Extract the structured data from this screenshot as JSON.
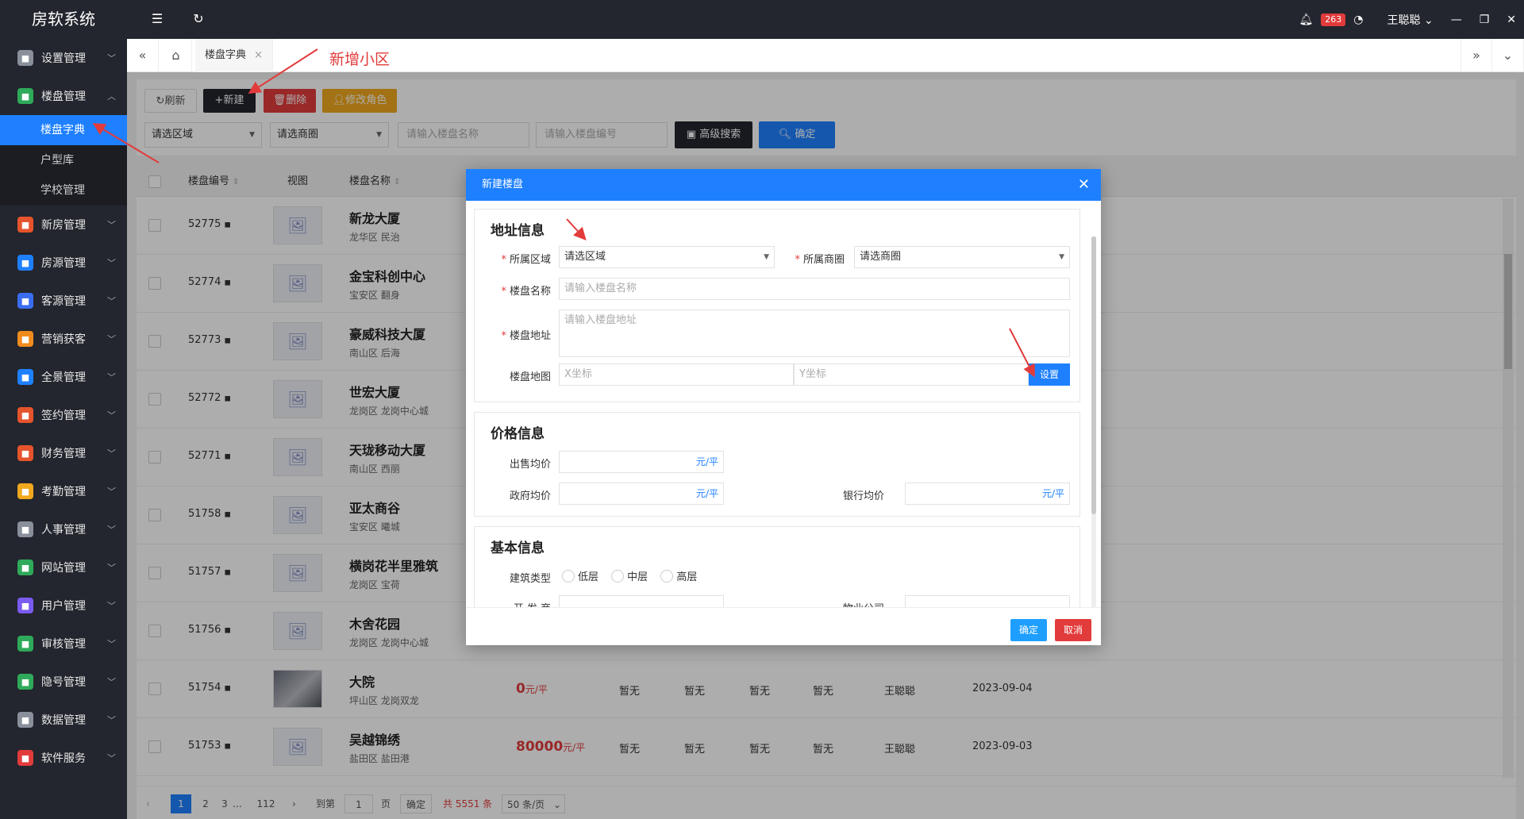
{
  "app": {
    "title": "房软系统",
    "notif_count": "263",
    "user": "王聪聪"
  },
  "sidebar": {
    "items": [
      {
        "label": "设置管理",
        "icon": "gear-icon",
        "color": "#8a8f9c"
      },
      {
        "label": "楼盘管理",
        "icon": "building-icon",
        "color": "#2eaa5a",
        "open": true,
        "children": [
          {
            "label": "楼盘字典",
            "active": true
          },
          {
            "label": "户型库"
          },
          {
            "label": "学校管理"
          }
        ]
      },
      {
        "label": "新房管理",
        "icon": "house-icon",
        "color": "#e5542d"
      },
      {
        "label": "房源管理",
        "icon": "home-icon",
        "color": "#1e80ff"
      },
      {
        "label": "客源管理",
        "icon": "users-icon",
        "color": "#3a6df0"
      },
      {
        "label": "营销获客",
        "icon": "share-icon",
        "color": "#f08c1e"
      },
      {
        "label": "全景管理",
        "icon": "panorama-icon",
        "color": "#1e80ff"
      },
      {
        "label": "签约管理",
        "icon": "contract-icon",
        "color": "#e5542d"
      },
      {
        "label": "财务管理",
        "icon": "finance-icon",
        "color": "#e5542d"
      },
      {
        "label": "考勤管理",
        "icon": "clock-icon",
        "color": "#f0a81e"
      },
      {
        "label": "人事管理",
        "icon": "person-icon",
        "color": "#8a8f9c"
      },
      {
        "label": "网站管理",
        "icon": "web-icon",
        "color": "#2eaa5a"
      },
      {
        "label": "用户管理",
        "icon": "user-icon",
        "color": "#7a5af0"
      },
      {
        "label": "审核管理",
        "icon": "audit-icon",
        "color": "#2eaa5a"
      },
      {
        "label": "隐号管理",
        "icon": "phone-icon",
        "color": "#2eaa5a"
      },
      {
        "label": "数据管理",
        "icon": "database-icon",
        "color": "#8a8f9c"
      },
      {
        "label": "软件服务",
        "icon": "alert-icon",
        "color": "#e23b3b"
      }
    ]
  },
  "tabs": {
    "current": "楼盘字典"
  },
  "toolbar": {
    "refresh": "刷新",
    "add": "新建",
    "delete": "删除",
    "edit_role": "修改角色",
    "region_placeholder": "请选区域",
    "district_placeholder": "请选商圈",
    "name_placeholder": "请输入楼盘名称",
    "code_placeholder": "请输入楼盘编号",
    "advanced": "高级搜索",
    "confirm": "确定"
  },
  "table": {
    "headers": {
      "code": "楼盘编号",
      "view": "视图",
      "name": "楼盘名称"
    },
    "rows": [
      {
        "code": "52775",
        "name": "新龙大厦",
        "area": "龙华区 民治"
      },
      {
        "code": "52774",
        "name": "金宝科创中心",
        "area": "宝安区 翻身"
      },
      {
        "code": "52773",
        "name": "豪威科技大厦",
        "area": "南山区 后海"
      },
      {
        "code": "52772",
        "name": "世宏大厦",
        "area": "龙岗区 龙岗中心城"
      },
      {
        "code": "52771",
        "name": "天珑移动大厦",
        "area": "南山区 西丽"
      },
      {
        "code": "51758",
        "name": "亚太商谷",
        "area": "宝安区 曦城"
      },
      {
        "code": "51757",
        "name": "横岗花半里雅筑",
        "area": "龙岗区 宝荷"
      },
      {
        "code": "51756",
        "name": "木舍花园",
        "area": "龙岗区 龙岗中心城"
      },
      {
        "code": "51754",
        "name": "大院",
        "area": "坪山区 龙岗双龙",
        "price": "0",
        "unit": "元/平",
        "c1": "暂无",
        "c2": "暂无",
        "c3": "暂无",
        "c4": "暂无",
        "owner": "王聪聪",
        "date": "2023-09-04"
      },
      {
        "code": "51753",
        "name": "吴越锦绣",
        "area": "盐田区 盐田港",
        "price": "80000",
        "unit": "元/平",
        "c1": "暂无",
        "c2": "暂无",
        "c3": "暂无",
        "c4": "暂无",
        "owner": "王聪聪",
        "date": "2023-09-03"
      }
    ]
  },
  "pager": {
    "p1": "1",
    "p2": "2",
    "p3": "3",
    "dots": "...",
    "last": "112",
    "goto": "到第",
    "goto_val": "1",
    "page": "页",
    "confirm": "确定",
    "total": "共 5551 条",
    "per_page": "50 条/页"
  },
  "modal": {
    "title": "新建楼盘",
    "addr_title": "地址信息",
    "region_label": "所属区域",
    "region_value": "请选区域",
    "district_label": "所属商圈",
    "district_value": "请选商圈",
    "name_label": "楼盘名称",
    "name_placeholder": "请输入楼盘名称",
    "address_label": "楼盘地址",
    "address_placeholder": "请输入楼盘地址",
    "map_label": "楼盘地图",
    "x_placeholder": "X坐标",
    "y_placeholder": "Y坐标",
    "set": "设置",
    "price_title": "价格信息",
    "sale_label": "出售均价",
    "gov_label": "政府均价",
    "bank_label": "银行均价",
    "unit": "元/平",
    "basic_title": "基本信息",
    "type_label": "建筑类型",
    "type_low": "低层",
    "type_mid": "中层",
    "type_high": "高层",
    "dev_label": "开 发 商",
    "prop_label": "物业公司",
    "ok": "确定",
    "cancel": "取消"
  },
  "annotation": {
    "text": "新增小区",
    "color": "#e23b3b"
  }
}
